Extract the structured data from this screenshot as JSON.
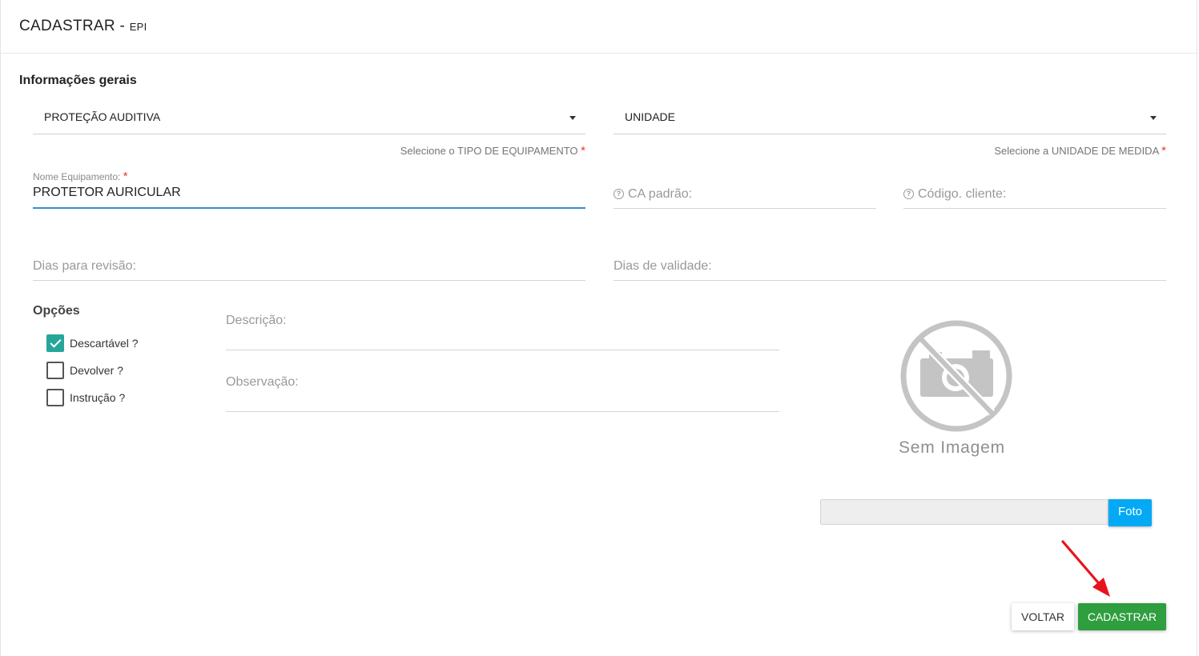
{
  "header": {
    "title": "CADASTRAR",
    "separator": " - ",
    "subtitle": "EPI"
  },
  "section": {
    "title": "Informações gerais"
  },
  "selects": {
    "equipment_type": {
      "value": "PROTEÇÃO AUDITIVA",
      "helper": "Selecione o TIPO DE EQUIPAMENTO"
    },
    "unit": {
      "value": "UNIDADE",
      "helper": "Selecione a UNIDADE DE MEDIDA"
    },
    "required_mark": "*"
  },
  "fields": {
    "equipment_name": {
      "label": "Nome Equipamento:",
      "value": "PROTETOR AURICULAR"
    },
    "ca_padrao": {
      "placeholder": "CA padrão:"
    },
    "codigo_cliente": {
      "placeholder": "Código. cliente:"
    },
    "dias_revisao": {
      "placeholder": "Dias para revisão:"
    },
    "dias_validade": {
      "placeholder": "Dias de validade:"
    },
    "descricao": {
      "placeholder": "Descrição:"
    },
    "observacao": {
      "placeholder": "Observação:"
    },
    "help_icon_glyph": "?"
  },
  "options": {
    "title": "Opções",
    "items": [
      {
        "label": "Descartável ?",
        "checked": true
      },
      {
        "label": "Devolver ?",
        "checked": false
      },
      {
        "label": "Instrução ?",
        "checked": false
      }
    ]
  },
  "image": {
    "placeholder_text": "Sem Imagem",
    "icon": "no-camera-icon"
  },
  "upload": {
    "button_label": "Foto"
  },
  "actions": {
    "back_label": "VOLTAR",
    "submit_label": "CADASTRAR"
  },
  "annotation": {
    "arrow_color": "#e8141c"
  },
  "colors": {
    "accent_blue": "#2f8fd8",
    "checkbox_teal": "#26a69a",
    "foto_blue": "#03a9f4",
    "submit_green": "#2e9e3e",
    "required_red": "#e53935"
  }
}
